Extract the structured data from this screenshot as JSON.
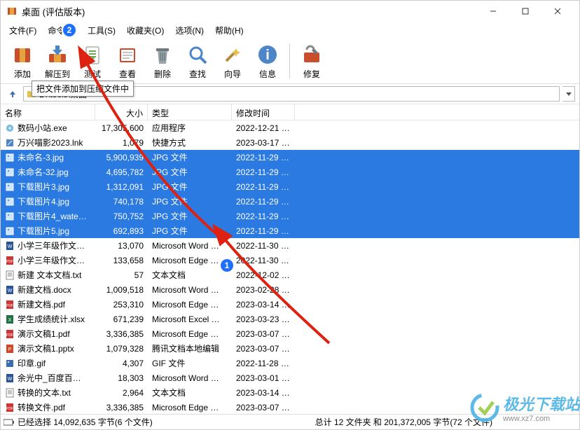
{
  "title": "桌面 (评估版本)",
  "menus": [
    "文件(F)",
    "命令(C)",
    "工具(S)",
    "收藏夹(O)",
    "选项(N)",
    "帮助(H)"
  ],
  "toolbar": [
    {
      "label": "添加",
      "icon": "add"
    },
    {
      "label": "解压到",
      "icon": "extract"
    },
    {
      "label": "测试",
      "icon": "test"
    },
    {
      "label": "查看",
      "icon": "view"
    },
    {
      "label": "删除",
      "icon": "delete"
    },
    {
      "label": "查找",
      "icon": "find"
    },
    {
      "label": "向导",
      "icon": "wizard"
    },
    {
      "label": "信息",
      "icon": "info"
    },
    {
      "label": "修复",
      "icon": "repair"
    }
  ],
  "toolbar_sep_after": 7,
  "tooltip": "把文件添加到压缩文件中",
  "badges": {
    "one": "1",
    "two": "2"
  },
  "address": "D:\\tools\\桌面",
  "columns": {
    "name": "名称",
    "size": "大小",
    "type": "类型",
    "date": "修改时间"
  },
  "files": [
    {
      "name": "数码小站.exe",
      "size": "17,305,600",
      "type": "应用程序",
      "date": "2022-12-21 1…",
      "icon": "exe",
      "sel": false
    },
    {
      "name": "万兴喵影2023.lnk",
      "size": "1,079",
      "type": "快捷方式",
      "date": "2023-03-17 1…",
      "icon": "lnk",
      "sel": false
    },
    {
      "name": "未命名-3.jpg",
      "size": "5,900,939",
      "type": "JPG 文件",
      "date": "2022-11-29 1…",
      "icon": "jpg",
      "sel": true
    },
    {
      "name": "未命名-32.jpg",
      "size": "4,695,782",
      "type": "JPG 文件",
      "date": "2022-11-29 1…",
      "icon": "jpg",
      "sel": true
    },
    {
      "name": "下载图片3.jpg",
      "size": "1,312,091",
      "type": "JPG 文件",
      "date": "2022-11-29 1…",
      "icon": "jpg",
      "sel": true
    },
    {
      "name": "下载图片4.jpg",
      "size": "740,178",
      "type": "JPG 文件",
      "date": "2022-11-29 1…",
      "icon": "jpg",
      "sel": true
    },
    {
      "name": "下载图片4_wate…",
      "size": "750,752",
      "type": "JPG 文件",
      "date": "2022-11-29 1…",
      "icon": "jpg",
      "sel": true
    },
    {
      "name": "下载图片5.jpg",
      "size": "692,893",
      "type": "JPG 文件",
      "date": "2022-11-29 1…",
      "icon": "jpg",
      "sel": true
    },
    {
      "name": "小学三年级作文…",
      "size": "13,070",
      "type": "Microsoft Word …",
      "date": "2022-11-30 9…",
      "icon": "docx",
      "sel": false
    },
    {
      "name": "小学三年级作文…",
      "size": "133,658",
      "type": "Microsoft Edge …",
      "date": "2022-11-30 8…",
      "icon": "pdf",
      "sel": false
    },
    {
      "name": "新建 文本文档.txt",
      "size": "57",
      "type": "文本文档",
      "date": "2022-12-02 9…",
      "icon": "txt",
      "sel": false
    },
    {
      "name": "新建文档.docx",
      "size": "1,009,518",
      "type": "Microsoft Word …",
      "date": "2023-02-28 1…",
      "icon": "docx",
      "sel": false
    },
    {
      "name": "新建文档.pdf",
      "size": "253,310",
      "type": "Microsoft Edge …",
      "date": "2023-03-14 1…",
      "icon": "pdf",
      "sel": false
    },
    {
      "name": "学生成绩统计.xlsx",
      "size": "671,239",
      "type": "Microsoft Excel …",
      "date": "2023-03-23 1…",
      "icon": "xlsx",
      "sel": false
    },
    {
      "name": "演示文稿1.pdf",
      "size": "3,336,385",
      "type": "Microsoft Edge …",
      "date": "2023-03-07 1…",
      "icon": "pdf",
      "sel": false
    },
    {
      "name": "演示文稿1.pptx",
      "size": "1,079,328",
      "type": "腾讯文档本地编辑",
      "date": "2023-03-07 1…",
      "icon": "pptx",
      "sel": false
    },
    {
      "name": "印章.gif",
      "size": "4,307",
      "type": "GIF 文件",
      "date": "2022-11-28 1…",
      "icon": "gif",
      "sel": false
    },
    {
      "name": "余光中_百度百…",
      "size": "18,303",
      "type": "Microsoft Word …",
      "date": "2023-03-01 1…",
      "icon": "docx",
      "sel": false
    },
    {
      "name": "转换的文本.txt",
      "size": "2,964",
      "type": "文本文档",
      "date": "2023-03-14 1…",
      "icon": "txt",
      "sel": false
    },
    {
      "name": "转换文件.pdf",
      "size": "3,336,385",
      "type": "Microsoft Edge …",
      "date": "2023-03-07 1…",
      "icon": "pdf",
      "sel": false
    }
  ],
  "status_left": "已经选择 14,092,635 字节(6 个文件)",
  "status_right": "总计 12 文件夹 和 201,372,005 字节(72 个文件)",
  "watermark_main": "极光下载站",
  "watermark_sub": "www.xz7.com"
}
